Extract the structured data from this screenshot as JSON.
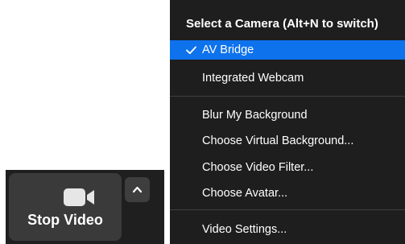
{
  "toolbar": {
    "video_button_label": "Stop Video",
    "video_icon": "video-camera-icon",
    "caret_icon": "chevron-up-icon"
  },
  "camera_menu": {
    "header": "Select a Camera (Alt+N to switch)",
    "cameras": [
      {
        "label": "AV Bridge",
        "selected": true
      },
      {
        "label": "Integrated Webcam",
        "selected": false
      }
    ],
    "background_items": [
      {
        "label": "Blur My Background"
      },
      {
        "label": "Choose Virtual Background..."
      },
      {
        "label": "Choose Video Filter..."
      },
      {
        "label": "Choose Avatar..."
      }
    ],
    "settings_item": {
      "label": "Video Settings..."
    },
    "selected_icon": "checkmark-icon"
  },
  "colors": {
    "selection_blue": "#0e72ed",
    "menu_background": "#1e1e1e",
    "toolbar_background": "#1f1f1f",
    "button_background": "#3a3a3a",
    "text": "#ffffff"
  }
}
